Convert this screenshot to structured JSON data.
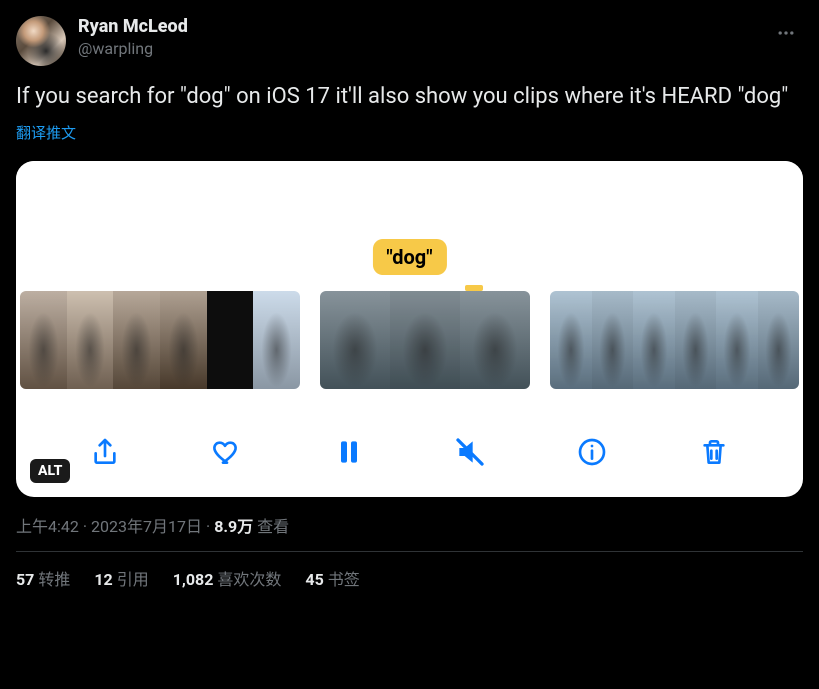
{
  "author": {
    "display_name": "Ryan McLeod",
    "handle": "@warpling"
  },
  "tweet_text": "If you search for \"dog\" on iOS 17 it'll also show you clips where it's HEARD \"dog\"",
  "translate_label": "翻译推文",
  "media": {
    "caption_bubble": "\"dog\"",
    "alt_label": "ALT"
  },
  "meta": {
    "time": "上午4:42",
    "date": "2023年7月17日",
    "views_number": "8.9万",
    "views_label": "查看"
  },
  "stats": {
    "retweets_num": "57",
    "retweets_label": "转推",
    "quotes_num": "12",
    "quotes_label": "引用",
    "likes_num": "1,082",
    "likes_label": "喜欢次数",
    "bookmarks_num": "45",
    "bookmarks_label": "书签"
  }
}
